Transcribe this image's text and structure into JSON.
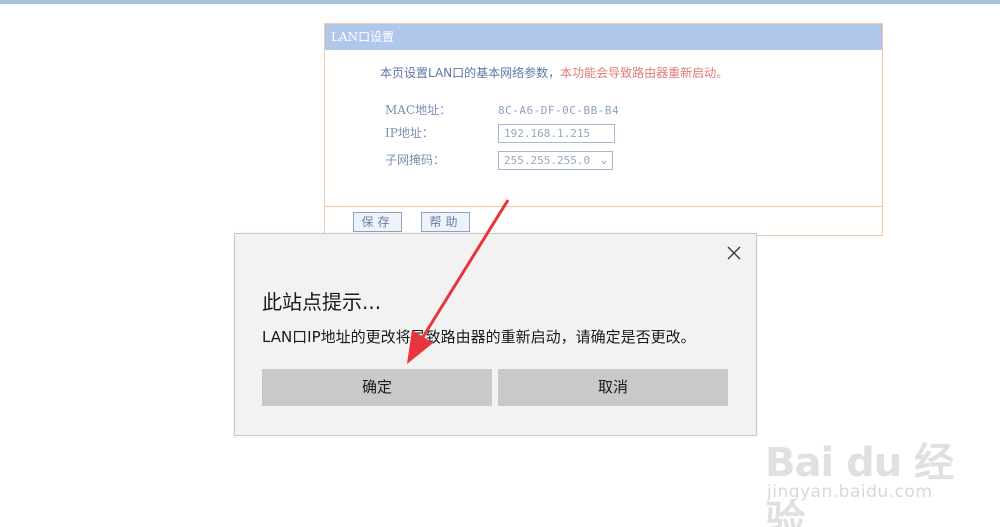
{
  "lan_panel": {
    "title": "LAN口设置",
    "intro_normal": "本页设置LAN口的基本网络参数，",
    "intro_warn": "本功能会导致路由器重新启动。",
    "fields": {
      "mac_label": "MAC地址：",
      "mac_value": "8C-A6-DF-0C-BB-B4",
      "ip_label": "IP地址：",
      "ip_value": "192.168.1.215",
      "mask_label": "子网掩码：",
      "mask_value": "255.255.255.0"
    },
    "save_label": "保存",
    "help_label": "帮助"
  },
  "dialog": {
    "title": "此站点提示...",
    "message": "LAN口IP地址的更改将导致路由器的重新启动，请确定是否更改。",
    "confirm_label": "确定",
    "cancel_label": "取消",
    "close_icon": "close-icon"
  },
  "watermark": {
    "logo": "Bai du 经验",
    "url": "jingyan.baidu.com"
  },
  "colors": {
    "accent": "#b0c7ec",
    "warn": "#e07a7a",
    "arrow": "#e8343a"
  }
}
